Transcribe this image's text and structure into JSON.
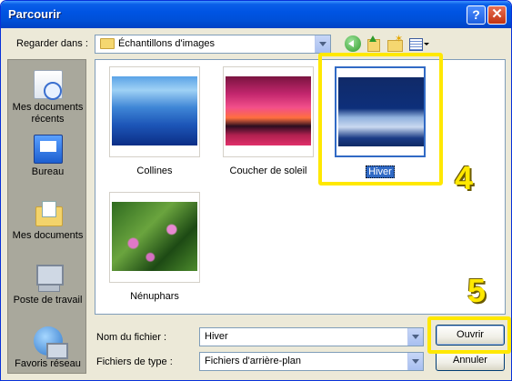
{
  "window": {
    "title": "Parcourir"
  },
  "lookin": {
    "label": "Regarder dans :",
    "value": "Échantillons d'images"
  },
  "places": [
    {
      "label": "Mes documents récents"
    },
    {
      "label": "Bureau"
    },
    {
      "label": "Mes documents"
    },
    {
      "label": "Poste de travail"
    },
    {
      "label": "Favoris réseau"
    }
  ],
  "files": [
    {
      "name": "Collines"
    },
    {
      "name": "Coucher de soleil"
    },
    {
      "name": "Hiver",
      "selected": true
    },
    {
      "name": "Nénuphars"
    }
  ],
  "filename": {
    "label": "Nom du fichier :",
    "value": "Hiver"
  },
  "filetype": {
    "label": "Fichiers de type :",
    "value": "Fichiers d'arrière-plan"
  },
  "buttons": {
    "open": "Ouvrir",
    "cancel": "Annuler"
  },
  "annotations": {
    "step4": "4",
    "step5": "5",
    "highlight_color": "#ffe800"
  },
  "colors": {
    "selection": "#316ac5",
    "titlebar": "#0054e3"
  }
}
